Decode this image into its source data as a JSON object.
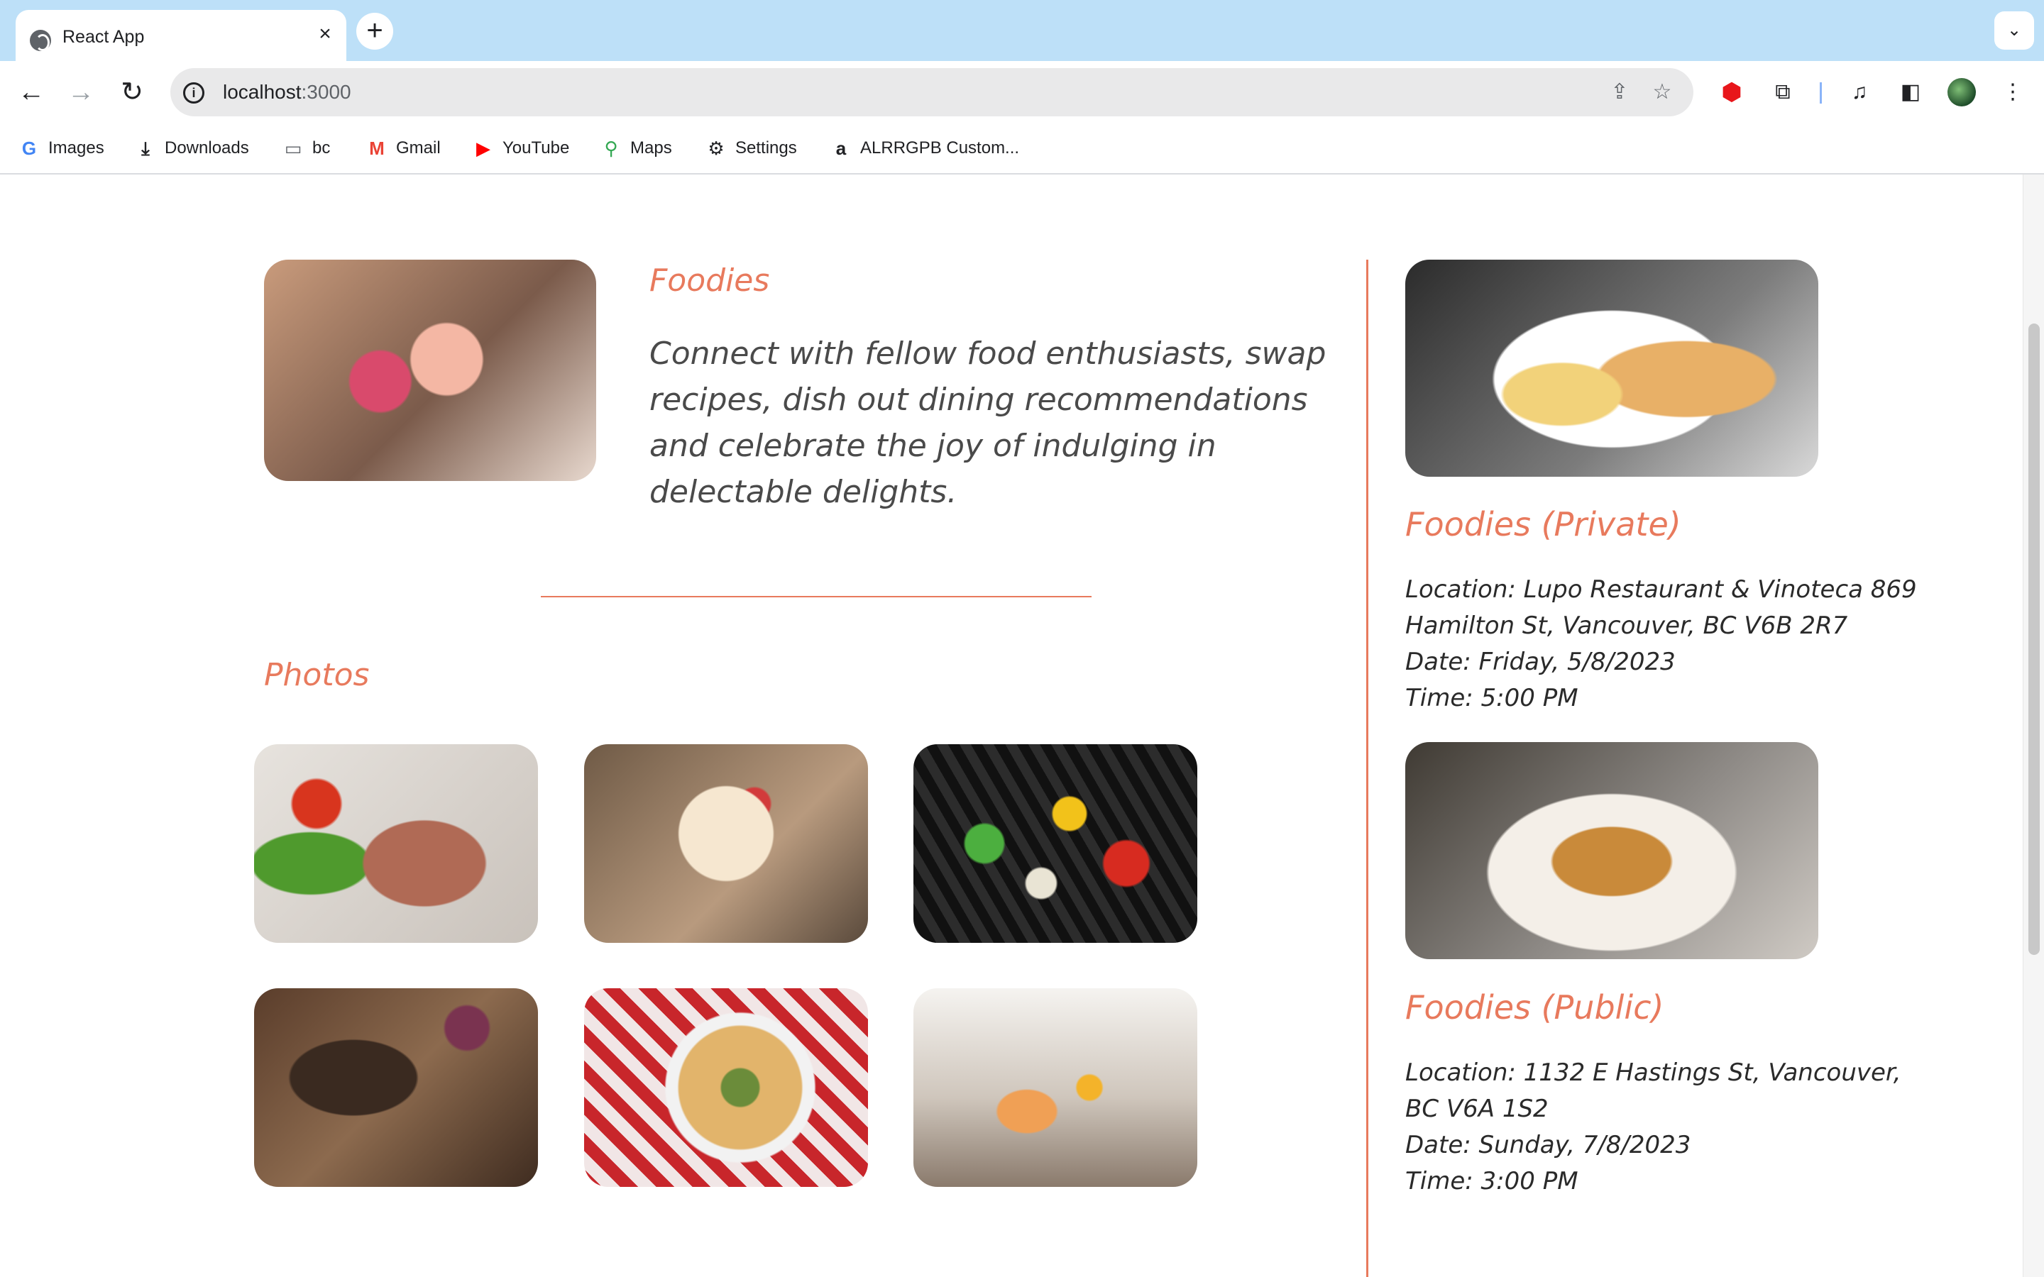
{
  "browser": {
    "tab_title": "React App",
    "url_host": "localhost",
    "url_port": ":3000",
    "bookmarks": [
      {
        "label": "Images",
        "icon": "google-icon"
      },
      {
        "label": "Downloads",
        "icon": "download-icon"
      },
      {
        "label": "bc",
        "icon": "folder-icon"
      },
      {
        "label": "Gmail",
        "icon": "gmail-icon"
      },
      {
        "label": "YouTube",
        "icon": "youtube-icon"
      },
      {
        "label": "Maps",
        "icon": "maps-icon"
      },
      {
        "label": "Settings",
        "icon": "gear-icon"
      },
      {
        "label": "ALRRGPB Custom...",
        "icon": "amazon-icon"
      }
    ]
  },
  "group": {
    "name": "Foodies",
    "description": "Connect with fellow food enthusiasts, swap recipes, dish out dining recommendations and celebrate the joy of indulging in delectable delights."
  },
  "photos": {
    "heading": "Photos",
    "items": [
      "steak-asparagus",
      "strawberry-cream-puffs",
      "grilled-skewers",
      "charcuterie-board",
      "pizza",
      "breakfast-table"
    ]
  },
  "events": [
    {
      "title": "Foodies (Private)",
      "location_label": "Location",
      "location": "Lupo Restaurant & Vinoteca 869 Hamilton St, Vancouver, BC V6B 2R7",
      "date_label": "Date",
      "date": "Friday, 5/8/2023",
      "time_label": "Time",
      "time": "5:00 PM"
    },
    {
      "title": "Foodies (Public)",
      "location_label": "Location",
      "location": "1132 E Hastings St, Vancouver, BC V6A 1S2",
      "date_label": "Date",
      "date": "Sunday, 7/8/2023",
      "time_label": "Time",
      "time": "3:00 PM"
    }
  ],
  "colors": {
    "accent": "#e87a5d",
    "tabstrip": "#bde0f8",
    "text": "#4a4a4a"
  }
}
